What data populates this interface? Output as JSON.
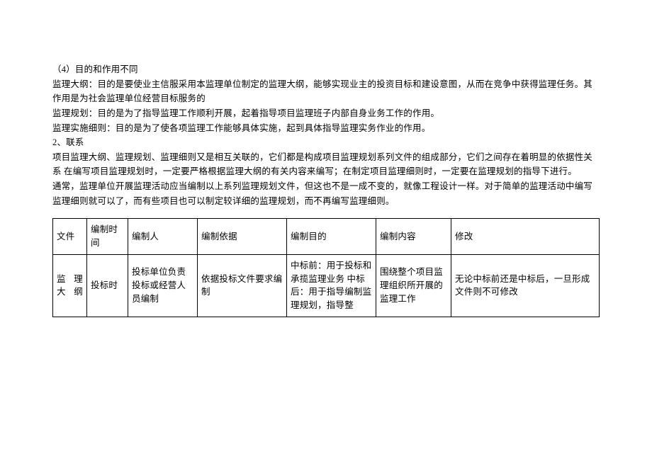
{
  "paragraphs": {
    "p1": "（4）目的和作用不同",
    "p2": "监理大纲：目的是要使业主信服采用本监理单位制定的监理大纲，能够实现业主的投资目标和建设意图，从而在竞争中获得监理任务。其作用是为社会监理单位经营目标服务的",
    "p3": "监理规划：目的是为了指导监理工作顺利开展，起着指导项目监理班子内部自身业务工作的作用。",
    "p4": "监理实施细则：目的是为了使各项监理工作能够具体实施，起到具体指导监理实务作业的作用。",
    "p5": "2、联系",
    "p6": "项目监理大纲、监理规划、监理细则又是相互关联的，它们都是构成项目监理规划系列文件的组成部分，它们之间存在着明显的依据性关系 在编写项目监理规划时，一定要严格根据监理大纲的有关内容来编写；在制定项目监理细则时，一定要在监理规划的指导下进行。",
    "p7": "通常，监理单位开展监理活动应当编制以上系列监理规划文件，但这也不是一成不变的，就像工程设计一样。对于简单的监理活动中编写监理细则就可以了，而有些项目也可以制定较详细的监理规划，而不再编写监理细则。"
  },
  "table": {
    "headers": {
      "file": "文件",
      "time": "编制时间",
      "author": "编制人",
      "basis": "编制依据",
      "purpose": "编制目的",
      "content": "编制内容",
      "modify": "修改"
    },
    "row1": {
      "file": "监 理大纲",
      "time": "投标时",
      "author": "投标单位负责投标或经营人员编制",
      "basis": "依据投标文件要求编制",
      "purpose": "中标前：用于投标和承揽监理业务 中标后：用于指导编制监理规划，指导整",
      "content": "围绕整个项目监理组织所开展的监理工作",
      "modify": "无论中标前还是中标后，一旦形成文件则不可修改"
    }
  }
}
